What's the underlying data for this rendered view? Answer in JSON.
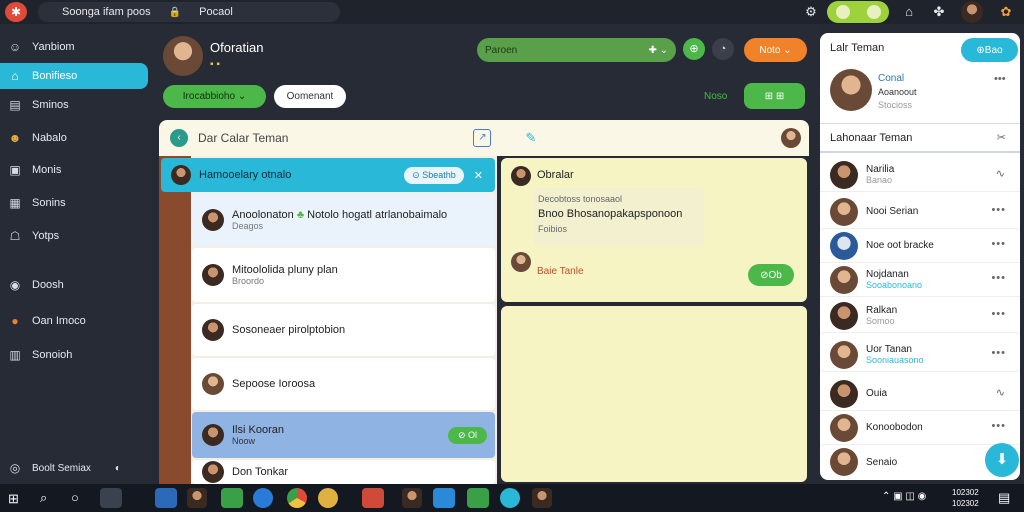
{
  "topbar": {
    "url_text": "Soonga ifam poos",
    "tab_label": "Pocaol"
  },
  "sidebar": {
    "items": [
      {
        "label": "Yanbiom",
        "icon": "user-icon"
      },
      {
        "label": "Bonifieso",
        "icon": "home-icon"
      },
      {
        "label": "Sminos",
        "icon": "calendar-icon"
      },
      {
        "label": "Nabalo",
        "icon": "people-icon"
      },
      {
        "label": "Monis",
        "icon": "chart-icon"
      },
      {
        "label": "Sonins",
        "icon": "grid-icon"
      },
      {
        "label": "Yotps",
        "icon": "chat-icon"
      },
      {
        "label": "Doosh",
        "icon": "power-icon"
      },
      {
        "label": "Oan Imoco",
        "icon": "badge-icon"
      },
      {
        "label": "Sonoioh",
        "icon": "building-icon"
      }
    ],
    "footer_label": "Boolt Semiax"
  },
  "header": {
    "name": "Oforatian",
    "search_placeholder": "Paroen",
    "orange_button": "Noto",
    "tag_green": "Irocabbioho",
    "tag_outline": "Oomenant",
    "right_text": "Noso"
  },
  "chatbar": {
    "title": "Dar Calar Teman"
  },
  "active_thread": {
    "title": "Hamooelary otnalo",
    "action": "Sbeathb"
  },
  "threads": [
    {
      "title": "Anoolonaton",
      "text": "Notolo hogatl atrlanobaimalo",
      "sub": "Deagos"
    },
    {
      "title": "Mitoololida pluny plan",
      "sub": "Broordo"
    },
    {
      "title": "Sosoneaer pirolptobion",
      "sub": ""
    },
    {
      "title": "Sepoose Ioroosa",
      "sub": ""
    },
    {
      "title": "Ilsi Kooran",
      "sub": "Noow",
      "action": "Ol"
    },
    {
      "title": "Don Tonkar",
      "sub": ""
    }
  ],
  "message": {
    "author": "Obralar",
    "meta": "Decobtoss tonosaaol",
    "text": "Bnoo Bhosanopakapsponoon",
    "time": "Foibios",
    "second_author": "Baie Tanle",
    "action": "Ob"
  },
  "friends_panel": {
    "title": "Lalr Teman",
    "button": "Bao",
    "profile": {
      "name": "Conal",
      "status": "Aoanoout",
      "sub": "Stocioss"
    },
    "section": "Lahonaar Teman",
    "list": [
      {
        "name": "Narilia",
        "sub": "Banao"
      },
      {
        "name": "Nooi Serian",
        "sub": ""
      },
      {
        "name": "Noe oot bracke",
        "sub": ""
      },
      {
        "name": "Nojdanan",
        "sub": "Sooabonoano"
      },
      {
        "name": "Ralkan",
        "sub": "Somoo"
      },
      {
        "name": "Uor Tanan",
        "sub": "Sooniauasono"
      },
      {
        "name": "Ouia",
        "sub": ""
      },
      {
        "name": "Konoobodon",
        "sub": ""
      },
      {
        "name": "Senaio",
        "sub": ""
      }
    ]
  },
  "taskbar": {
    "time": "102302",
    "date": "102302"
  },
  "colors": {
    "accent": "#2ab8d8",
    "green": "#4cb84a",
    "orange": "#f0832a"
  }
}
